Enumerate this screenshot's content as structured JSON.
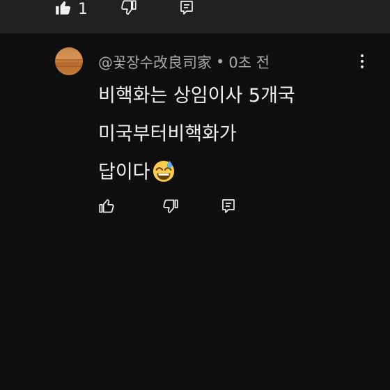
{
  "top_bar": {
    "like_count": "1"
  },
  "comment": {
    "author": "@꽃장수改良司家",
    "separator": "•",
    "time": "0초 전",
    "text_lines": [
      "비핵화는 상임이사 5개국",
      "미국부터비핵화가",
      "답이다"
    ],
    "emoji": "grinning-face-with-sweat-emoji"
  },
  "icons": {
    "like": "thumbs-up-icon",
    "dislike": "thumbs-down-icon",
    "reply": "reply-icon",
    "more": "more-vert-icon"
  },
  "colors": {
    "background": "#0f0f0f",
    "top_bar": "#212121",
    "text": "#f1f1f1",
    "meta": "#aaaaaa"
  }
}
